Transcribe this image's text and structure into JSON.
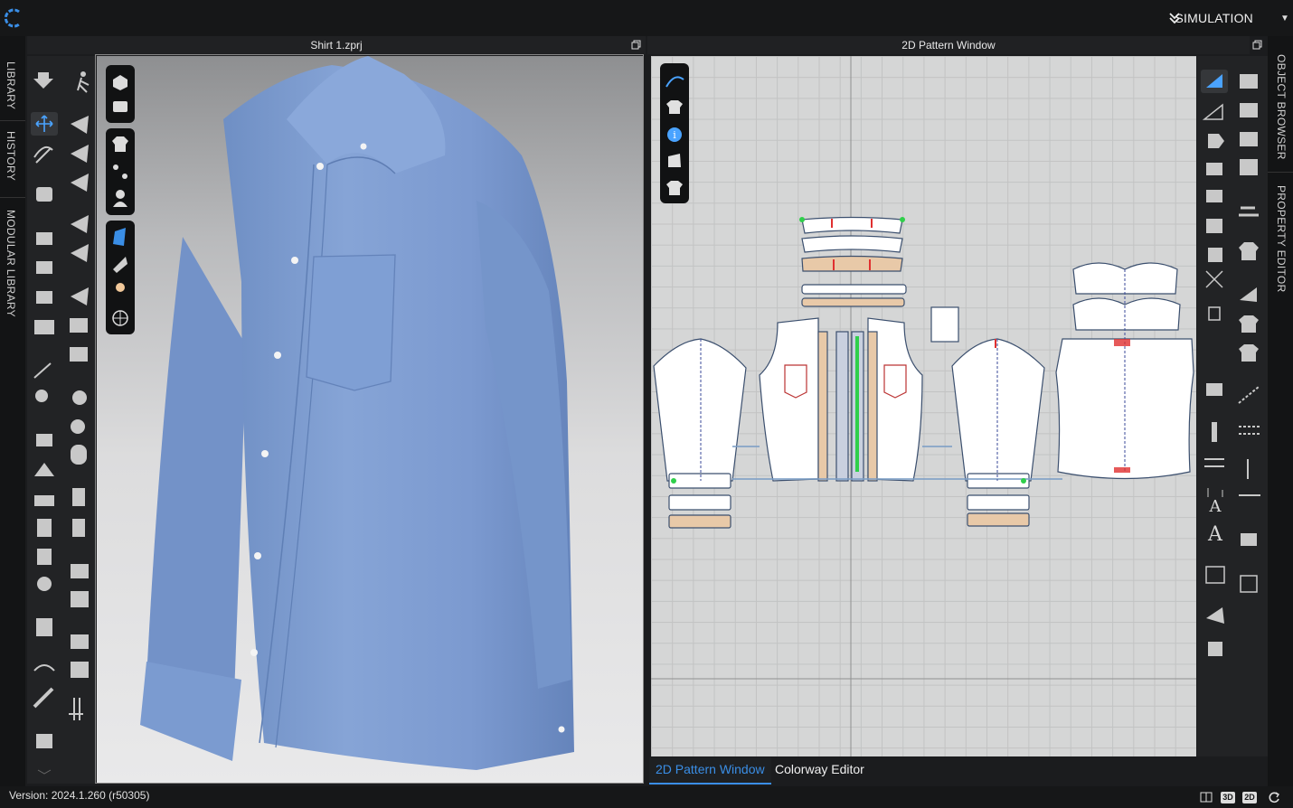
{
  "header": {
    "mode_label": "SIMULATION"
  },
  "side_tabs_left": [
    "LIBRARY",
    "HISTORY",
    "MODULAR LIBRARY"
  ],
  "side_tabs_right": [
    "OBJECT BROWSER",
    "PROPERTY EDITOR"
  ],
  "windows": {
    "view3d_title": "Shirt 1.zprj",
    "pattern_title": "2D Pattern Window"
  },
  "bottom_tabs": [
    {
      "label": "2D Pattern Window",
      "active": true
    },
    {
      "label": "Colorway Editor",
      "active": false
    }
  ],
  "status": {
    "version": "Version: 2024.1.260 (r50305)",
    "view_buttons": [
      "3D",
      "2D"
    ]
  },
  "colors": {
    "accent": "#3a8ee6",
    "shirt": "#7f9fd2",
    "binding": "#e8c9a8"
  },
  "icons": [
    "logo-icon",
    "expand-icon",
    "window-restore-icon",
    "pen-icon",
    "shirt-icon",
    "info-icon",
    "camera-icon",
    "globe-icon",
    "avatar-icon",
    "text-icon",
    "layout-single-icon",
    "refresh-icon"
  ]
}
